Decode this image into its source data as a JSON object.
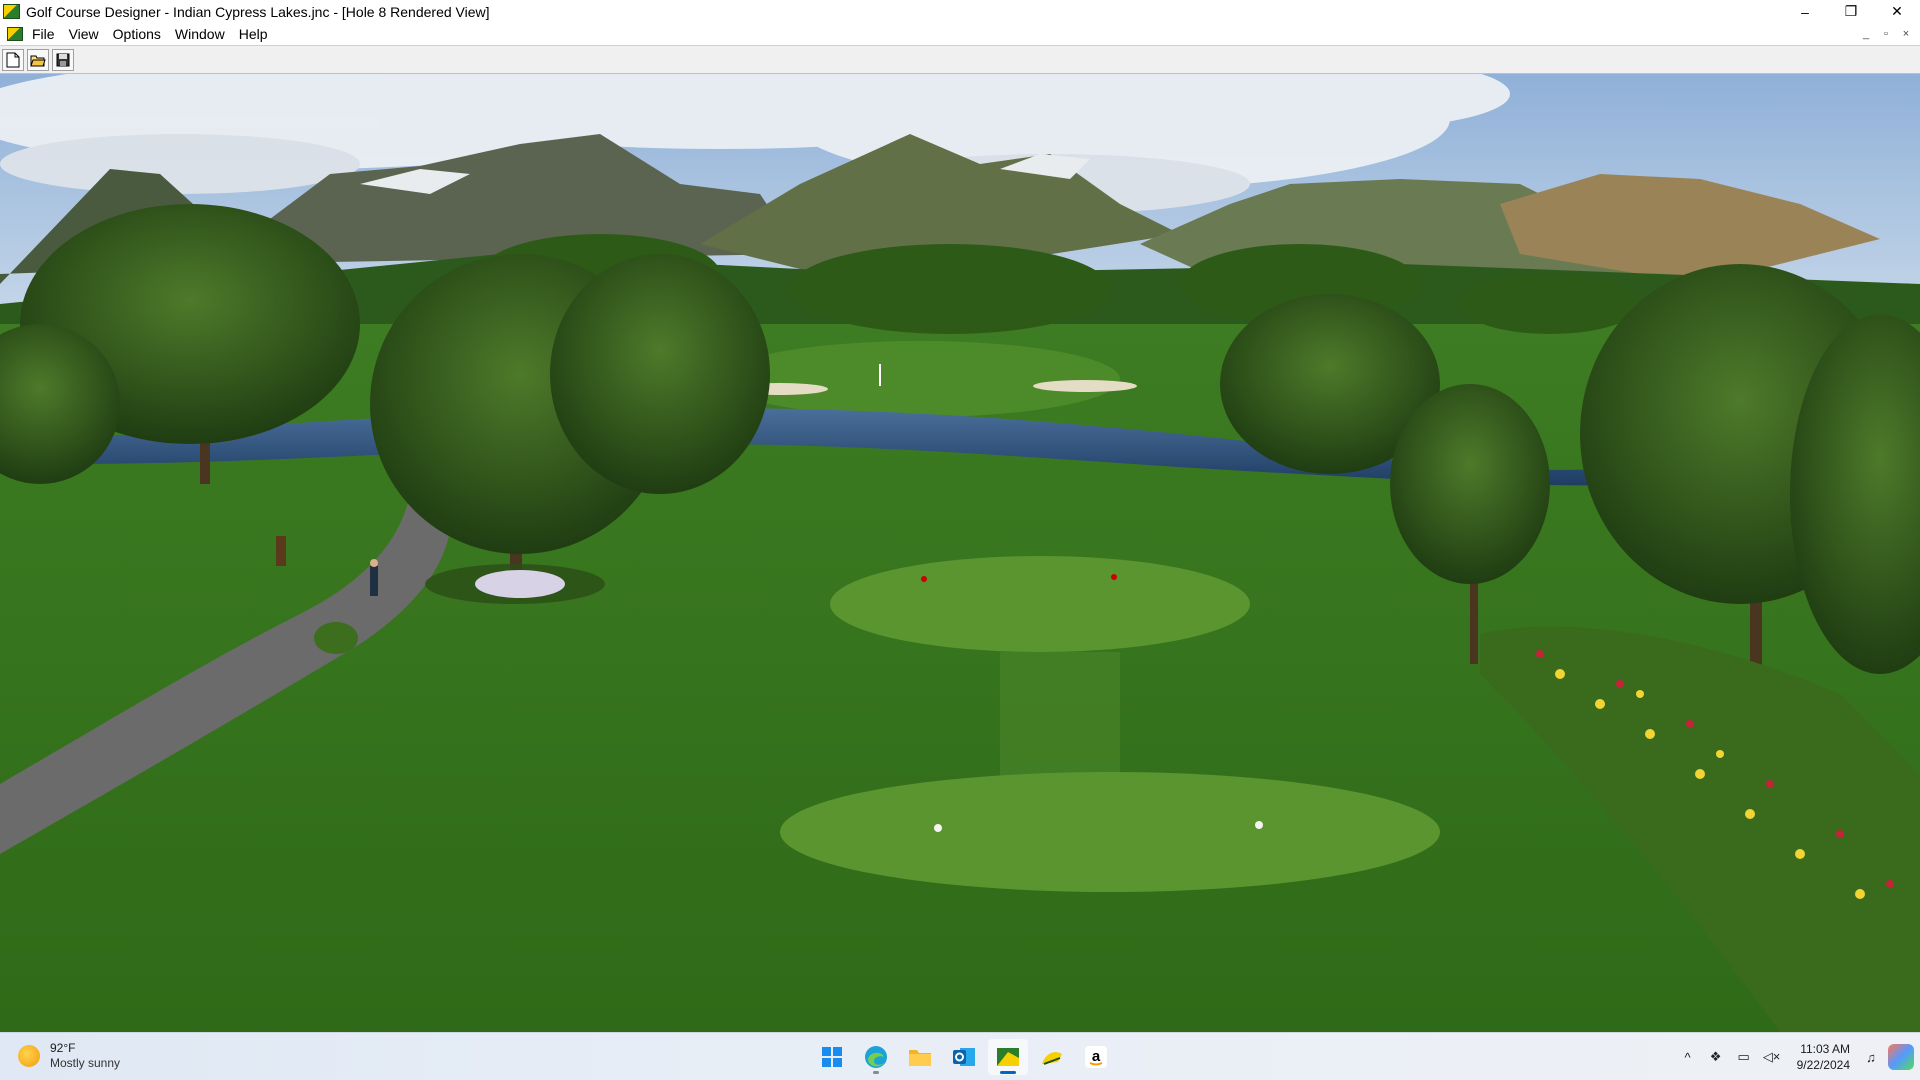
{
  "window": {
    "title": "Golf Course Designer - Indian Cypress Lakes.jnc - [Hole 8 Rendered View]",
    "controls": {
      "minimize": "–",
      "restore": "❐",
      "close": "✕"
    }
  },
  "menu": {
    "items": [
      "File",
      "View",
      "Options",
      "Window",
      "Help"
    ],
    "mdi_controls": {
      "minimize": "_",
      "restore": "▫",
      "close": "×"
    }
  },
  "toolbar": {
    "buttons": [
      "new-file-icon",
      "open-folder-icon",
      "save-disk-icon"
    ]
  },
  "viewport": {
    "scene": "hole-8-rendered-view",
    "colors": {
      "sky": "#7aa6d6",
      "fairway": "#3f7f1f",
      "tee": "#5b9a2e",
      "water": "#2b4f7a",
      "path": "#6a6a6a"
    }
  },
  "taskbar": {
    "weather": {
      "temp": "92°F",
      "condition": "Mostly sunny",
      "icon": "sun-icon"
    },
    "apps": [
      "windows-start-icon",
      "edge-browser-icon",
      "file-explorer-icon",
      "outlook-icon",
      "golf-course-designer-icon",
      "golf-app-icon",
      "amazon-icon"
    ],
    "tray": [
      "chevron-up-icon",
      "dropbox-icon",
      "network-icon",
      "volume-muted-icon"
    ],
    "time": "11:03 AM",
    "date": "9/22/2024"
  }
}
